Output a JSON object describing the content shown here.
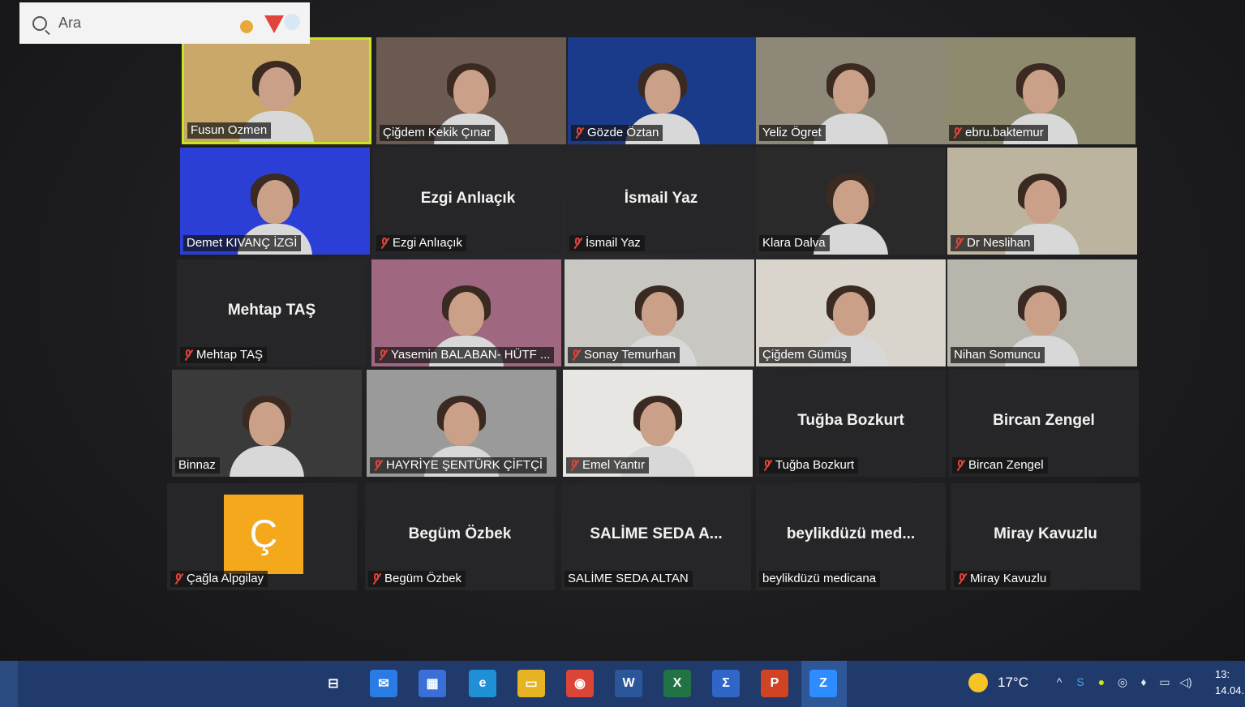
{
  "participants": [
    {
      "name": "Fusun Ozmen",
      "muted": false,
      "video": true,
      "active": true
    },
    {
      "name": "Çiğdem Kekik Çınar",
      "muted": false,
      "video": true
    },
    {
      "name": "Gözde Öztan",
      "muted": true,
      "video": true
    },
    {
      "name": "Yeliz Ögret",
      "muted": false,
      "video": true
    },
    {
      "name": "ebru.baktemur",
      "muted": true,
      "video": true
    },
    {
      "name": "Demet KIVANÇ İZGİ",
      "muted": false,
      "video": true
    },
    {
      "name": "Ezgi Anlıaçık",
      "muted": true,
      "video": false,
      "display": "Ezgi Anlıaçık"
    },
    {
      "name": "İsmail Yaz",
      "muted": true,
      "video": false,
      "display": "İsmail Yaz"
    },
    {
      "name": "Klara Dalva",
      "muted": false,
      "video": true
    },
    {
      "name": "Dr Neslihan",
      "muted": true,
      "video": true
    },
    {
      "name": "Mehtap TAŞ",
      "muted": true,
      "video": false,
      "display": "Mehtap TAŞ"
    },
    {
      "name": "Yasemin BALABAN- HÜTF ...",
      "muted": true,
      "video": true
    },
    {
      "name": "Sonay Temurhan",
      "muted": true,
      "video": true
    },
    {
      "name": "Çiğdem Gümüş",
      "muted": false,
      "video": true
    },
    {
      "name": "Nihan Somuncu",
      "muted": false,
      "video": true
    },
    {
      "name": "Binnaz",
      "muted": false,
      "video": true
    },
    {
      "name": "HAYRİYE ŞENTÜRK ÇİFTÇİ",
      "muted": true,
      "video": true
    },
    {
      "name": "Emel Yantır",
      "muted": true,
      "video": true
    },
    {
      "name": "Tuğba Bozkurt",
      "muted": true,
      "video": false,
      "display": "Tuğba Bozkurt"
    },
    {
      "name": "Bircan Zengel",
      "muted": true,
      "video": false,
      "display": "Bircan Zengel"
    },
    {
      "name": "Çağla Alpgilay",
      "muted": true,
      "video": false,
      "avatar_letter": "Ç"
    },
    {
      "name": "Begüm Özbek",
      "muted": true,
      "video": false,
      "display": "Begüm Özbek"
    },
    {
      "name": "SALİME SEDA ALTAN",
      "muted": false,
      "video": false,
      "display": "SALİME SEDA A..."
    },
    {
      "name": "beylikdüzü medicana",
      "muted": false,
      "video": false,
      "display": "beylikdüzü  med..."
    },
    {
      "name": "Miray Kavuzlu",
      "muted": true,
      "video": false,
      "display": "Miray Kavuzlu"
    }
  ],
  "taskbar": {
    "search_placeholder": "Ara",
    "apps": [
      {
        "name": "task-view-icon",
        "glyph": "⊟"
      },
      {
        "name": "mail-icon",
        "glyph": "✉"
      },
      {
        "name": "store-icon",
        "glyph": "▦"
      },
      {
        "name": "edge-icon",
        "glyph": "e"
      },
      {
        "name": "file-explorer-icon",
        "glyph": "▭"
      },
      {
        "name": "chrome-icon",
        "glyph": "◉"
      },
      {
        "name": "word-icon",
        "glyph": "W"
      },
      {
        "name": "excel-icon",
        "glyph": "X"
      },
      {
        "name": "sigma-icon",
        "glyph": "Σ"
      },
      {
        "name": "powerpoint-icon",
        "glyph": "P"
      },
      {
        "name": "zoom-icon",
        "glyph": "Z"
      }
    ],
    "colors": {
      "taskbar": "#1f3a6b",
      "active_speaker": "#c8e61e",
      "mic_off": "#e0443a",
      "avatar": "#f4a81c"
    },
    "temperature": "17°C",
    "clock_time": "13:",
    "clock_date": "14.04."
  }
}
